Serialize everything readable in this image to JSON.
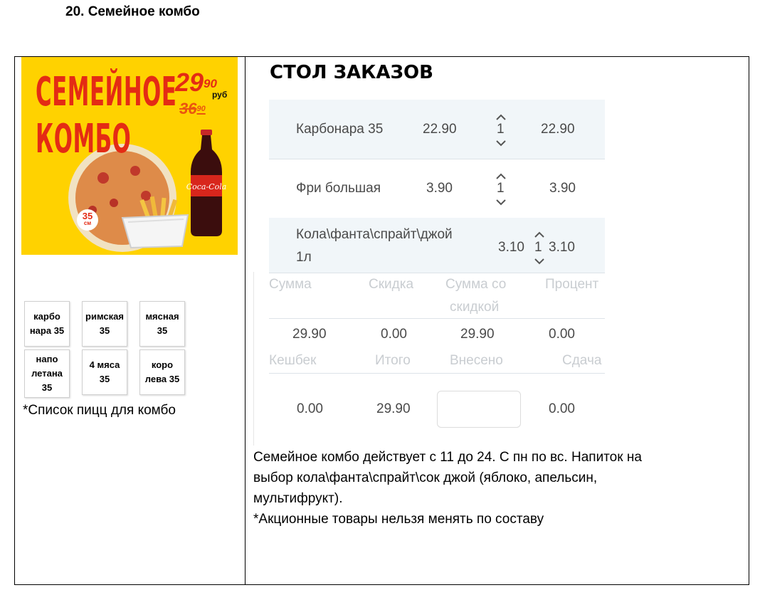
{
  "heading": "20. Семейное комбо",
  "poster": {
    "title_line1": "СЕМЕЙНОЕ",
    "title_line2": "КОМБО",
    "price_new_int": "29",
    "price_new_frac": "90",
    "currency": "руб",
    "price_old_int": "36",
    "price_old_frac": "90",
    "size_value": "35",
    "size_unit": "см",
    "cola_label": "Coca-Cola",
    "brand_color": "#e42b14",
    "background_color": "#ffd200"
  },
  "pizza_buttons": [
    {
      "label": "карбо\nнара 35"
    },
    {
      "label": "римская\n35"
    },
    {
      "label": "мясная\n35"
    },
    {
      "label": "напо\nлетана\n35"
    },
    {
      "label": "4 мяса\n35"
    },
    {
      "label": "коро\nлева 35"
    }
  ],
  "pizza_note": "*Список пицц для комбо",
  "order": {
    "title": "СТОЛ ЗАКАЗОВ",
    "rows": [
      {
        "name": "Карбонара 35",
        "price": "22.90",
        "qty": "1",
        "total": "22.90"
      },
      {
        "name": "Фри большая",
        "price": "3.90",
        "qty": "1",
        "total": "3.90"
      },
      {
        "name_line1": "Кола\\фанта\\спрайт\\джой",
        "name_line2": "1л",
        "price": "3.10",
        "qty": "1",
        "total": "3.10"
      }
    ],
    "summary_headers": {
      "sum": "Сумма",
      "discount": "Скидка",
      "sum_disc_line1": "Сумма со",
      "sum_disc_line2": "скидкой",
      "percent": "Процент"
    },
    "summary_values": {
      "sum": "29.90",
      "discount": "0.00",
      "sum_disc": "29.90",
      "percent": "0.00"
    },
    "totals_headers": {
      "cashback": "Кешбек",
      "total": "Итого",
      "paid": "Внесено",
      "change": "Сдача"
    },
    "totals_values": {
      "cashback": "0.00",
      "total": "29.90",
      "paid": "",
      "change": "0.00"
    }
  },
  "description": {
    "line1": "Семейное комбо действует с 11 до 24. С пн по вс. Напиток на",
    "line2": "выбор кола\\фанта\\спрайт\\сок джой (яблоко, апельсин,",
    "line3": "мультифрукт).",
    "line4": "*Акционные товары нельзя менять по составу"
  }
}
